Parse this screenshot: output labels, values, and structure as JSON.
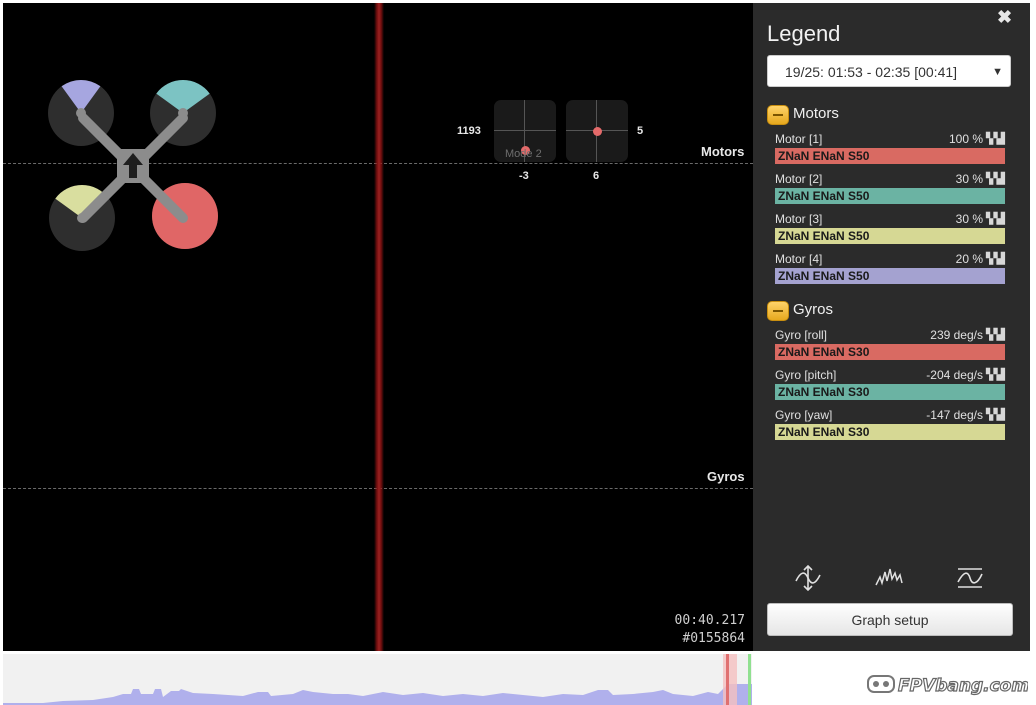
{
  "graph": {
    "labels": {
      "motors": "Motors",
      "gyros": "Gyros"
    },
    "sticks": {
      "left": {
        "value_left": "1193",
        "value_bottom": "-3",
        "dot_x": 0.5,
        "dot_y": 0.82
      },
      "right": {
        "value_right": "5",
        "value_bottom": "6",
        "dot_x": 0.5,
        "dot_y": 0.5
      },
      "mode_label": "Mode 2"
    },
    "time": "00:40.217",
    "frame": "#0155864"
  },
  "craft": {
    "motor_colors": [
      "#e06666",
      "#7cc3c3",
      "#d9de9f",
      "#a6a6e0"
    ],
    "motor_levels": [
      1.0,
      0.3,
      0.3,
      0.2
    ]
  },
  "legend": {
    "title": "Legend",
    "log_selector": "19/25: 01:53 - 02:35 [00:41]",
    "groups": [
      {
        "name": "Motors",
        "fields": [
          {
            "name": "Motor [1]",
            "value": "100 %",
            "bar": "ZNaN ENaN S50",
            "color": "#d96a62"
          },
          {
            "name": "Motor [2]",
            "value": "30 %",
            "bar": "ZNaN ENaN S50",
            "color": "#6bb3a3"
          },
          {
            "name": "Motor [3]",
            "value": "30 %",
            "bar": "ZNaN ENaN S50",
            "color": "#d6d894"
          },
          {
            "name": "Motor [4]",
            "value": "20 %",
            "bar": "ZNaN ENaN S50",
            "color": "#a4a2d0"
          }
        ]
      },
      {
        "name": "Gyros",
        "fields": [
          {
            "name": "Gyro [roll]",
            "value": "239 deg/s",
            "bar": "ZNaN ENaN S30",
            "color": "#d96a62"
          },
          {
            "name": "Gyro [pitch]",
            "value": "-204 deg/s",
            "bar": "ZNaN ENaN S30",
            "color": "#6bb3a3"
          },
          {
            "name": "Gyro [yaw]",
            "value": "-147 deg/s",
            "bar": "ZNaN ENaN S30",
            "color": "#d6d894"
          }
        ]
      }
    ],
    "setup_button": "Graph setup"
  },
  "watermark": "FPVbang.com"
}
